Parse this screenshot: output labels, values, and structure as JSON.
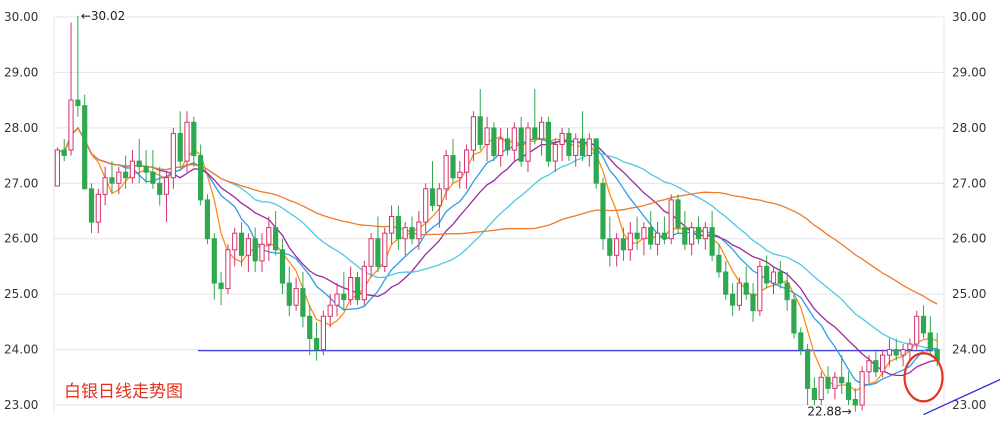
{
  "caption": "白银日线走势图",
  "chart_data": {
    "type": "candlestick",
    "title": "",
    "xlabel": "",
    "ylabel": "",
    "ylim": [
      22.9,
      30.2
    ],
    "y_ticks": [
      "30.00",
      "29.00",
      "28.00",
      "27.00",
      "26.00",
      "25.00",
      "24.00",
      "23.00"
    ],
    "grid": true,
    "colors": {
      "up": "#d6336c",
      "down": "#2fa84f",
      "ma_short": "#ff8c1a",
      "ma_mid": "#2b9de8",
      "ma_long": "#9c2a9c",
      "ma_support": "#4fc8e0",
      "ma_slow": "#f07a2a",
      "trendline": "#2a2ad8",
      "circle": "#e8321e"
    },
    "annotations": {
      "high_label": "←30.02",
      "low_label": "22.88→",
      "high_value": 30.02,
      "low_value": 22.88
    },
    "support_level": 23.98,
    "trendline_points": [
      [
        147,
        22.9
      ],
      [
        160,
        24.3
      ]
    ],
    "circle_center": [
      161,
      23.5
    ],
    "candles": [
      [
        26.95,
        27.65,
        26.95,
        27.6
      ],
      [
        27.6,
        27.8,
        27.4,
        27.5
      ],
      [
        27.6,
        29.9,
        27.5,
        28.5
      ],
      [
        28.5,
        30.02,
        28.2,
        28.4
      ],
      [
        28.4,
        28.6,
        26.9,
        26.9
      ],
      [
        26.9,
        27.0,
        26.1,
        26.3
      ],
      [
        26.3,
        26.9,
        26.1,
        26.8
      ],
      [
        26.8,
        27.3,
        26.6,
        27.1
      ],
      [
        27.1,
        27.4,
        26.8,
        27.0
      ],
      [
        27.0,
        27.3,
        26.8,
        27.2
      ],
      [
        27.2,
        27.5,
        26.9,
        27.1
      ],
      [
        27.1,
        27.6,
        27.0,
        27.4
      ],
      [
        27.4,
        27.8,
        27.0,
        27.3
      ],
      [
        27.3,
        27.6,
        27.0,
        27.2
      ],
      [
        27.2,
        27.6,
        26.9,
        27.0
      ],
      [
        27.0,
        27.3,
        26.6,
        26.8
      ],
      [
        26.8,
        27.2,
        26.3,
        27.1
      ],
      [
        27.1,
        28.0,
        26.9,
        27.9
      ],
      [
        27.9,
        28.3,
        27.3,
        27.4
      ],
      [
        27.4,
        28.3,
        27.2,
        28.1
      ],
      [
        28.1,
        28.2,
        27.3,
        27.5
      ],
      [
        27.5,
        27.7,
        26.6,
        26.7
      ],
      [
        26.7,
        26.8,
        25.9,
        26.0
      ],
      [
        26.0,
        26.1,
        24.9,
        25.2
      ],
      [
        25.2,
        25.4,
        24.8,
        25.1
      ],
      [
        25.1,
        25.9,
        25.0,
        25.8
      ],
      [
        25.8,
        26.2,
        25.5,
        26.1
      ],
      [
        26.1,
        26.3,
        25.5,
        25.7
      ],
      [
        25.7,
        26.1,
        25.4,
        26.0
      ],
      [
        26.0,
        26.2,
        25.4,
        25.6
      ],
      [
        25.6,
        26.1,
        25.4,
        25.9
      ],
      [
        25.9,
        26.4,
        25.6,
        26.2
      ],
      [
        26.2,
        26.5,
        25.7,
        25.8
      ],
      [
        25.8,
        26.0,
        25.0,
        25.2
      ],
      [
        25.2,
        25.5,
        24.6,
        24.8
      ],
      [
        24.8,
        25.3,
        24.7,
        25.1
      ],
      [
        25.1,
        25.4,
        24.4,
        24.6
      ],
      [
        24.6,
        24.8,
        23.9,
        24.2
      ],
      [
        24.2,
        24.5,
        23.8,
        24.0
      ],
      [
        24.0,
        24.7,
        23.9,
        24.6
      ],
      [
        24.6,
        25.0,
        24.4,
        24.8
      ],
      [
        24.8,
        25.2,
        24.6,
        25.0
      ],
      [
        25.0,
        25.4,
        24.7,
        24.9
      ],
      [
        24.9,
        25.5,
        24.8,
        25.3
      ],
      [
        25.3,
        25.4,
        24.8,
        24.9
      ],
      [
        24.9,
        25.6,
        24.8,
        25.5
      ],
      [
        25.5,
        26.1,
        25.3,
        26.0
      ],
      [
        26.0,
        26.4,
        25.4,
        25.5
      ],
      [
        25.5,
        26.2,
        25.4,
        26.1
      ],
      [
        26.1,
        26.6,
        25.9,
        26.4
      ],
      [
        26.4,
        26.6,
        25.8,
        26.0
      ],
      [
        26.0,
        26.3,
        25.7,
        26.2
      ],
      [
        26.2,
        26.4,
        25.9,
        26.0
      ],
      [
        26.0,
        26.5,
        25.8,
        26.3
      ],
      [
        26.3,
        27.0,
        26.1,
        26.9
      ],
      [
        26.9,
        27.4,
        26.5,
        26.6
      ],
      [
        26.6,
        27.0,
        26.2,
        26.9
      ],
      [
        26.9,
        27.6,
        26.7,
        27.5
      ],
      [
        27.5,
        27.8,
        27.0,
        27.1
      ],
      [
        27.1,
        27.4,
        26.9,
        27.2
      ],
      [
        27.2,
        27.7,
        26.9,
        27.6
      ],
      [
        27.6,
        28.3,
        27.4,
        28.2
      ],
      [
        28.2,
        28.7,
        27.6,
        27.7
      ],
      [
        27.7,
        28.2,
        27.4,
        28.0
      ],
      [
        28.0,
        28.1,
        27.4,
        27.5
      ],
      [
        27.5,
        28.0,
        27.3,
        27.8
      ],
      [
        27.8,
        28.0,
        27.5,
        27.6
      ],
      [
        27.6,
        28.1,
        27.4,
        28.0
      ],
      [
        28.0,
        28.2,
        27.3,
        27.4
      ],
      [
        27.4,
        28.1,
        27.2,
        28.0
      ],
      [
        28.0,
        28.7,
        27.7,
        27.8
      ],
      [
        27.8,
        28.2,
        27.5,
        28.1
      ],
      [
        28.1,
        28.2,
        27.3,
        27.4
      ],
      [
        27.4,
        27.8,
        27.2,
        27.7
      ],
      [
        27.7,
        28.0,
        27.4,
        27.9
      ],
      [
        27.9,
        28.0,
        27.4,
        27.5
      ],
      [
        27.5,
        27.9,
        27.3,
        27.8
      ],
      [
        27.8,
        28.3,
        27.4,
        27.5
      ],
      [
        27.5,
        27.9,
        27.3,
        27.8
      ],
      [
        27.8,
        27.8,
        26.9,
        27.0
      ],
      [
        27.0,
        27.1,
        25.8,
        26.0
      ],
      [
        26.0,
        26.4,
        25.5,
        25.7
      ],
      [
        25.7,
        26.1,
        25.5,
        26.0
      ],
      [
        26.0,
        26.2,
        25.6,
        25.8
      ],
      [
        25.8,
        26.3,
        25.6,
        26.1
      ],
      [
        26.1,
        26.4,
        25.8,
        26.0
      ],
      [
        26.0,
        26.3,
        25.7,
        26.2
      ],
      [
        26.2,
        26.5,
        25.8,
        25.9
      ],
      [
        25.9,
        26.3,
        25.7,
        26.1
      ],
      [
        26.1,
        26.4,
        25.9,
        26.0
      ],
      [
        26.0,
        26.8,
        25.9,
        26.7
      ],
      [
        26.7,
        26.8,
        26.1,
        26.2
      ],
      [
        26.2,
        26.5,
        25.8,
        25.9
      ],
      [
        25.9,
        26.3,
        25.7,
        26.2
      ],
      [
        26.2,
        26.4,
        25.9,
        26.0
      ],
      [
        26.0,
        26.3,
        25.8,
        26.2
      ],
      [
        26.2,
        26.5,
        25.6,
        25.7
      ],
      [
        25.7,
        25.9,
        25.3,
        25.4
      ],
      [
        25.4,
        25.6,
        24.9,
        25.0
      ],
      [
        25.0,
        25.2,
        24.6,
        24.8
      ],
      [
        24.8,
        25.3,
        24.7,
        25.2
      ],
      [
        25.2,
        25.5,
        24.9,
        25.0
      ],
      [
        25.0,
        25.2,
        24.5,
        24.7
      ],
      [
        24.7,
        25.6,
        24.6,
        25.5
      ],
      [
        25.5,
        25.7,
        25.1,
        25.2
      ],
      [
        25.2,
        25.5,
        25.0,
        25.4
      ],
      [
        25.4,
        25.6,
        25.1,
        25.2
      ],
      [
        25.2,
        25.4,
        24.7,
        24.9
      ],
      [
        24.9,
        25.0,
        24.2,
        24.3
      ],
      [
        24.3,
        24.4,
        23.9,
        24.0
      ],
      [
        24.0,
        24.1,
        23.0,
        23.3
      ],
      [
        23.3,
        23.5,
        23.0,
        23.1
      ],
      [
        23.1,
        23.6,
        23.0,
        23.5
      ],
      [
        23.5,
        23.7,
        23.2,
        23.3
      ],
      [
        23.3,
        23.6,
        23.1,
        23.5
      ],
      [
        23.5,
        23.9,
        23.2,
        23.4
      ],
      [
        23.4,
        23.6,
        23.0,
        23.1
      ],
      [
        23.1,
        23.3,
        22.88,
        23.0
      ],
      [
        23.0,
        23.7,
        22.9,
        23.6
      ],
      [
        23.6,
        23.9,
        23.4,
        23.8
      ],
      [
        23.8,
        24.0,
        23.5,
        23.6
      ],
      [
        23.6,
        24.0,
        23.5,
        23.9
      ],
      [
        23.9,
        24.2,
        23.7,
        24.0
      ],
      [
        24.0,
        24.2,
        23.8,
        23.9
      ],
      [
        23.9,
        24.1,
        23.7,
        24.0
      ],
      [
        24.0,
        24.2,
        23.8,
        24.1
      ],
      [
        24.1,
        24.7,
        24.0,
        24.6
      ],
      [
        24.6,
        24.8,
        24.2,
        24.3
      ],
      [
        24.3,
        24.6,
        23.9,
        24.0
      ],
      [
        24.0,
        24.3,
        23.7,
        23.8
      ]
    ]
  }
}
